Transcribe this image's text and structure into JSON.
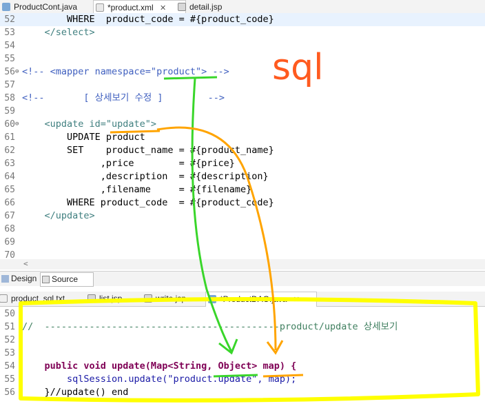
{
  "top_tabs": [
    {
      "label": "ProductCont.java",
      "icon": "java-file-icon",
      "active": false
    },
    {
      "label": "*product.xml",
      "icon": "xml-file-icon",
      "active": true
    },
    {
      "label": "detail.jsp",
      "icon": "jsp-file-icon",
      "active": false
    }
  ],
  "close_glyph": "✕",
  "xml_editor": {
    "lines": [
      {
        "n": "52",
        "t": "        WHERE  product_code = #{product_code}"
      },
      {
        "n": "53",
        "t": "    </select>"
      },
      {
        "n": "54",
        "t": ""
      },
      {
        "n": "55",
        "t": ""
      },
      {
        "n": "56",
        "t": "<!-- <mapper namespace=\"product\"> -->"
      },
      {
        "n": "57",
        "t": ""
      },
      {
        "n": "58",
        "t": "<!--       [ 상세보기 수정 ]        -->"
      },
      {
        "n": "59",
        "t": ""
      },
      {
        "n": "60",
        "t": "    <update id=\"update\">"
      },
      {
        "n": "61",
        "t": "        UPDATE product"
      },
      {
        "n": "62",
        "t": "        SET    product_name = #{product_name}"
      },
      {
        "n": "63",
        "t": "              ,price        = #{price}"
      },
      {
        "n": "64",
        "t": "              ,description  = #{description}"
      },
      {
        "n": "65",
        "t": "              ,filename     = #{filename}"
      },
      {
        "n": "66",
        "t": "        WHERE product_code  = #{product_code}"
      },
      {
        "n": "67",
        "t": "    </update>"
      },
      {
        "n": "68",
        "t": ""
      },
      {
        "n": "69",
        "t": ""
      },
      {
        "n": "70",
        "t": ""
      }
    ]
  },
  "mode_tabs": [
    {
      "label": "Design",
      "active": false
    },
    {
      "label": "Source",
      "active": true
    }
  ],
  "bottom_tabs": [
    {
      "label": "product_sql.txt",
      "icon": "txt-file-icon",
      "active": false
    },
    {
      "label": "list.jsp",
      "icon": "jsp-file-icon",
      "active": false
    },
    {
      "label": "write.jsp",
      "icon": "jsp-file-icon",
      "active": false
    },
    {
      "label": "*ProductDAO.java",
      "icon": "java-file-icon",
      "active": true
    }
  ],
  "java_editor": {
    "lines": [
      {
        "n": "50",
        "t": ""
      },
      {
        "n": "51",
        "t": "//  ------------------------------------------product/update 상세보기"
      },
      {
        "n": "52",
        "t": ""
      },
      {
        "n": "53",
        "t": ""
      },
      {
        "n": "54",
        "t": "    public void update(Map<String, Object> map) {"
      },
      {
        "n": "55",
        "t": "        sqlSession.update(\"product.update\", map);"
      },
      {
        "n": "56",
        "t": "    }//update() end"
      }
    ]
  },
  "annotation": {
    "text": "sql",
    "colors": {
      "red": "#ff5a1f",
      "green": "#39d62a",
      "orange": "#ffa400",
      "yellow": "#ffff00"
    }
  }
}
